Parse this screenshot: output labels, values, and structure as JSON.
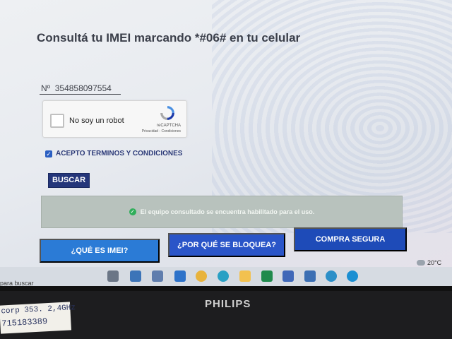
{
  "page": {
    "title": "Consultá tu IMEI marcando *#06# en tu celular",
    "imei_field": {
      "value": "Nº  354858097554"
    },
    "recaptcha": {
      "label": "No soy un robot",
      "brand": "reCAPTCHA",
      "links": "Privacidad - Condiciones"
    },
    "terms": {
      "label": "ACEPTO TERMINOS Y CONDICIONES",
      "checked": true
    },
    "search_button": "BUSCAR",
    "status": {
      "text": "El equipo consultado se encuentra habilitado para el uso.",
      "color": "#2fae5a"
    },
    "actions": [
      {
        "label": "¿QUÉ ES IMEI?"
      },
      {
        "label": "¿POR QUÉ SE BLOQUEA?"
      },
      {
        "label": "COMPRA SEGURA"
      }
    ],
    "accent": "#24367a"
  },
  "taskbar": {
    "search_text": "para buscar",
    "temperature": "20°C",
    "icons": [
      "task-view-icon",
      "store-icon",
      "notepad-icon",
      "mail-icon",
      "chrome-icon",
      "globe-icon",
      "folder-icon",
      "excel-icon",
      "remote-icon",
      "clock-icon",
      "network-icon",
      "edge-icon"
    ]
  },
  "monitor": {
    "brand": "PHILIPS",
    "sticker": [
      "corp 353. 2,4GHz",
      "715183389"
    ]
  }
}
